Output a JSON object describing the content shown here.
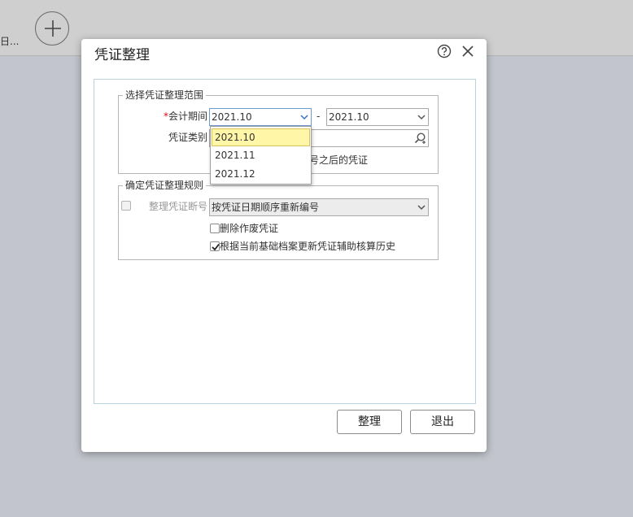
{
  "background": {
    "truncated_text": "日...",
    "add_icon": "plus-icon"
  },
  "dialog": {
    "title": "凭证整理",
    "help_icon": "question-circle-icon",
    "close_icon": "close-icon",
    "range_group": {
      "legend": "选择凭证整理范围",
      "period": {
        "required_mark": "*",
        "label": "会计期间",
        "start_value": "2021.10",
        "separator": "-",
        "end_value": "2021.10"
      },
      "voucher_type": {
        "label": "凭证类别",
        "value": ""
      },
      "partial_text": "号之后的凭证"
    },
    "rule_group": {
      "legend": "确定凭证整理规则",
      "renumber_label": "整理凭证断号",
      "renumber_checked": false,
      "renumber_option": "按凭证日期顺序重新编号",
      "delete_void": {
        "label": "删除作废凭证",
        "checked": false
      },
      "update_history": {
        "label": "根据当前基础档案更新凭证辅助核算历史",
        "checked": true
      }
    },
    "buttons": {
      "organize": "整理",
      "exit": "退出"
    },
    "dropdown": {
      "options": [
        "2021.10",
        "2021.11",
        "2021.12"
      ],
      "selected": "2021.10"
    }
  }
}
